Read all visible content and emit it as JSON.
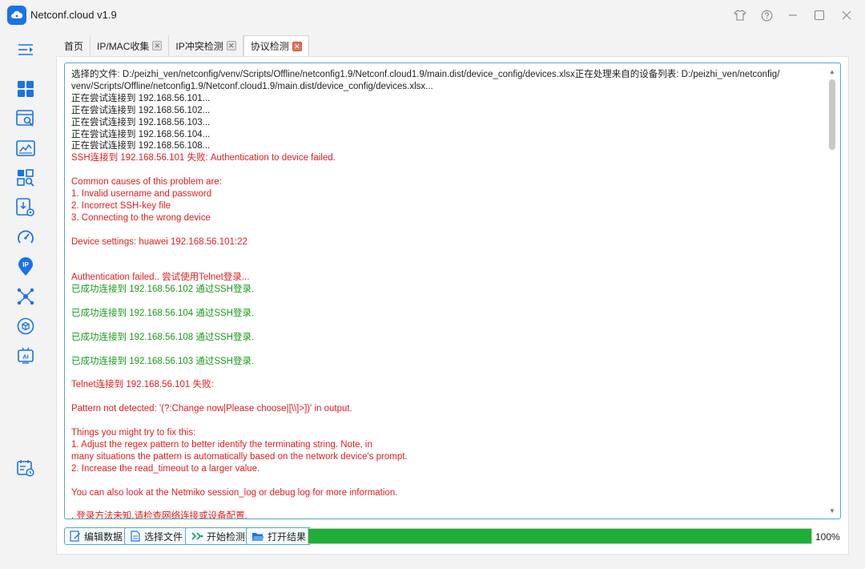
{
  "window": {
    "title": "Netconf.cloud v1.9",
    "controls": [
      "shirt-icon",
      "help-icon",
      "minimize-icon",
      "maximize-icon",
      "close-icon"
    ]
  },
  "sidebar": {
    "items": [
      "menu-toggle-icon",
      "dashboard-icon",
      "search-report-icon",
      "monitor-icon",
      "scan-icon",
      "download-settings-icon",
      "gauge-icon",
      "ip-location-icon",
      "network-nodes-icon",
      "package-icon",
      "ai-icon",
      "schedule-icon"
    ]
  },
  "tabs": [
    {
      "label": "首页",
      "closable": false
    },
    {
      "label": "IP/MAC收集",
      "closable": true
    },
    {
      "label": "IP冲突检测",
      "closable": true
    },
    {
      "label": "协议检测",
      "closable": true,
      "active": true
    }
  ],
  "log": {
    "lines": [
      {
        "text": "选择的文件: D:/peizhi_ven/netconfig/venv/Scripts/Offline/netconfig1.9/Netconf.cloud1.9/main.dist/device_config/devices.xlsx正在处理来自的设备列表: D:/peizhi_ven/netconfig/",
        "color": "black"
      },
      {
        "text": "venv/Scripts/Offline/netconfig1.9/Netconf.cloud1.9/main.dist/device_config/devices.xlsx...",
        "color": "black"
      },
      {
        "text": "正在尝试连接到 192.168.56.101...",
        "color": "black"
      },
      {
        "text": "正在尝试连接到 192.168.56.102...",
        "color": "black"
      },
      {
        "text": "正在尝试连接到 192.168.56.103...",
        "color": "black"
      },
      {
        "text": "正在尝试连接到 192.168.56.104...",
        "color": "black"
      },
      {
        "text": "正在尝试连接到 192.168.56.108...",
        "color": "black"
      },
      {
        "text": "SSH连接到 192.168.56.101 失败: Authentication to device failed.",
        "color": "red"
      },
      {
        "text": "",
        "color": "red"
      },
      {
        "text": "Common causes of this problem are:",
        "color": "red"
      },
      {
        "text": "1. Invalid username and password",
        "color": "red"
      },
      {
        "text": "2. Incorrect SSH-key file",
        "color": "red"
      },
      {
        "text": "3. Connecting to the wrong device",
        "color": "red"
      },
      {
        "text": "",
        "color": "red"
      },
      {
        "text": "Device settings: huawei 192.168.56.101:22",
        "color": "red"
      },
      {
        "text": "",
        "color": "red"
      },
      {
        "text": "",
        "color": "red"
      },
      {
        "text": "Authentication failed.. 尝试使用Telnet登录...",
        "color": "red"
      },
      {
        "text": "已成功连接到 192.168.56.102 通过SSH登录.",
        "color": "green"
      },
      {
        "text": "",
        "color": "green"
      },
      {
        "text": "已成功连接到 192.168.56.104 通过SSH登录.",
        "color": "green"
      },
      {
        "text": "",
        "color": "green"
      },
      {
        "text": "已成功连接到 192.168.56.108 通过SSH登录.",
        "color": "green"
      },
      {
        "text": "",
        "color": "green"
      },
      {
        "text": "已成功连接到 192.168.56.103 通过SSH登录.",
        "color": "green"
      },
      {
        "text": "",
        "color": "green"
      },
      {
        "text": "Telnet连接到 192.168.56.101 失败:",
        "color": "red"
      },
      {
        "text": "",
        "color": "red"
      },
      {
        "text": "Pattern not detected: '(?:Change now|Please choose|[\\\\]>])' in output.",
        "color": "red"
      },
      {
        "text": "",
        "color": "red"
      },
      {
        "text": "Things you might try to fix this:",
        "color": "red"
      },
      {
        "text": "1. Adjust the regex pattern to better identify the terminating string. Note, in",
        "color": "red"
      },
      {
        "text": "many situations the pattern is automatically based on the network device's prompt.",
        "color": "red"
      },
      {
        "text": "2. Increase the read_timeout to a larger value.",
        "color": "red"
      },
      {
        "text": "",
        "color": "red"
      },
      {
        "text": "You can also look at the Netmiko session_log or debug log for more information.",
        "color": "red"
      },
      {
        "text": "",
        "color": "red"
      },
      {
        "text": ". 登录方法未知,请检查网络连接或设备配置.",
        "color": "red"
      }
    ]
  },
  "toolbar": {
    "edit_label": "编辑数据",
    "select_label": "选择文件",
    "start_label": "开始检测",
    "open_label": "打开结果"
  },
  "progress": {
    "value": 100,
    "text": "100%",
    "color": "#1fae3a"
  }
}
